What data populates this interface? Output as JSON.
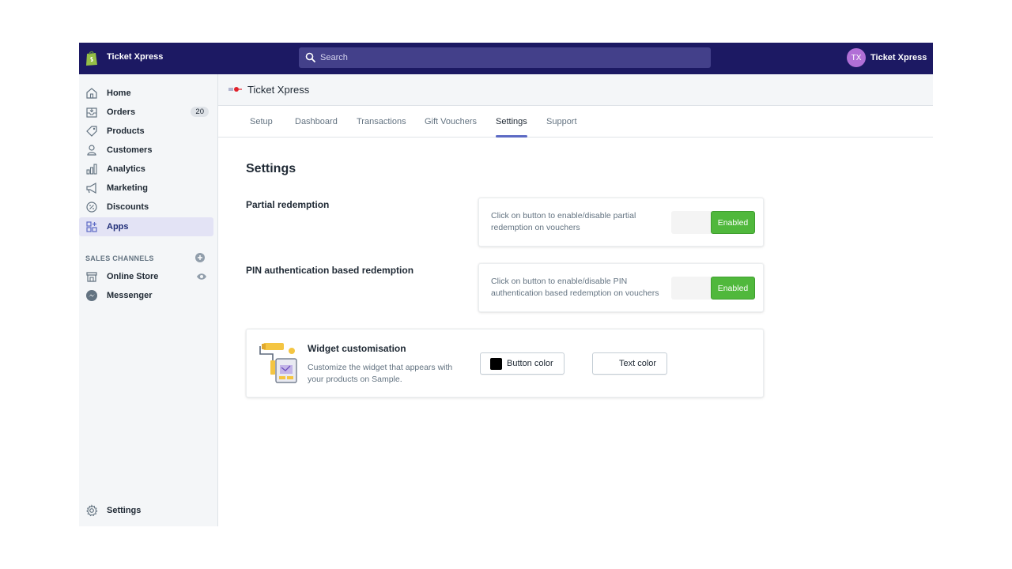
{
  "topbar": {
    "store_name": "Ticket Xpress",
    "search_placeholder": "Search",
    "avatar_initials": "TX",
    "user_name": "Ticket Xpress"
  },
  "sidebar": {
    "items": [
      {
        "label": "Home",
        "icon": "home-icon"
      },
      {
        "label": "Orders",
        "icon": "orders-icon",
        "badge": "20"
      },
      {
        "label": "Products",
        "icon": "tag-icon"
      },
      {
        "label": "Customers",
        "icon": "person-icon"
      },
      {
        "label": "Analytics",
        "icon": "analytics-icon"
      },
      {
        "label": "Marketing",
        "icon": "megaphone-icon"
      },
      {
        "label": "Discounts",
        "icon": "discount-icon"
      },
      {
        "label": "Apps",
        "icon": "apps-icon",
        "active": true
      }
    ],
    "sales_channels_title": "SALES CHANNELS",
    "channels": [
      {
        "label": "Online Store",
        "icon": "store-icon"
      },
      {
        "label": "Messenger",
        "icon": "messenger-icon"
      }
    ],
    "settings_label": "Settings"
  },
  "app": {
    "title": "Ticket Xpress",
    "tabs": [
      "Setup",
      "Dashboard",
      "Transactions",
      "Gift Vouchers",
      "Settings",
      "Support"
    ],
    "active_tab": "Settings"
  },
  "settings": {
    "page_title": "Settings",
    "partial": {
      "title": "Partial redemption",
      "description": "Click on button to enable/disable partial redemption on vouchers",
      "button": "Enabled"
    },
    "pin": {
      "title": "PIN authentication based redemption",
      "description": "Click on button to enable/disable PIN authentication based redemption on vouchers",
      "button": "Enabled"
    },
    "widget": {
      "title": "Widget customisation",
      "description": "Customize the widget that appears with your products on Sample.",
      "button_color_label": "Button color",
      "button_color_value": "#000000",
      "text_color_label": "Text color",
      "text_color_value": "#ffffff"
    }
  },
  "colors": {
    "topbar": "#1c1963",
    "accent": "#5c6ac4",
    "enabled": "#50b83c"
  }
}
